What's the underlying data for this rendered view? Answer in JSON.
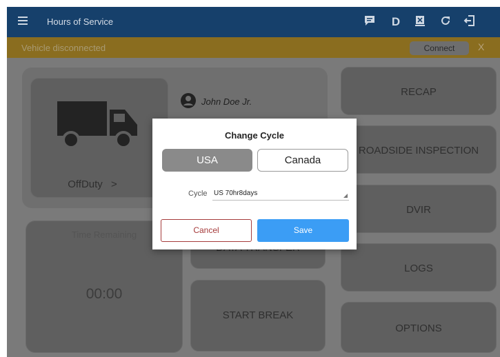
{
  "app_bar": {
    "title": "Hours of Service",
    "icons": [
      "menu-icon",
      "message-icon",
      "d-status-icon",
      "inspection-icon",
      "refresh-icon",
      "logout-icon"
    ],
    "d_label": "D",
    "background": "#16406b"
  },
  "status_bar": {
    "message": "Vehicle disconnected",
    "connect_label": "Connect",
    "dismiss_label": "X",
    "background": "#8a6d1f"
  },
  "driver_card": {
    "name": "John Doe Jr.",
    "status_label": "OffDuty",
    "status_chevron": ">",
    "icons": [
      "truck-icon",
      "person-icon"
    ]
  },
  "time_card": {
    "label": "Time Remaining",
    "value": "00:00"
  },
  "tiles": {
    "data_transfer": "DATA TRANSFER",
    "start_break": "START BREAK",
    "recap": "RECAP",
    "roadside_inspection": "ROADSIDE INSPECTION",
    "dvir": "DVIR",
    "logs": "LOGS",
    "options": "OPTIONS"
  },
  "dialog": {
    "title": "Change Cycle",
    "segments": [
      "USA",
      "Canada"
    ],
    "selected_segment": "USA",
    "cycle_label": "Cycle",
    "cycle_value": "US 70hr8days",
    "cancel_label": "Cancel",
    "save_label": "Save",
    "save_color": "#3b9df5",
    "cancel_color": "#a53a3a"
  }
}
